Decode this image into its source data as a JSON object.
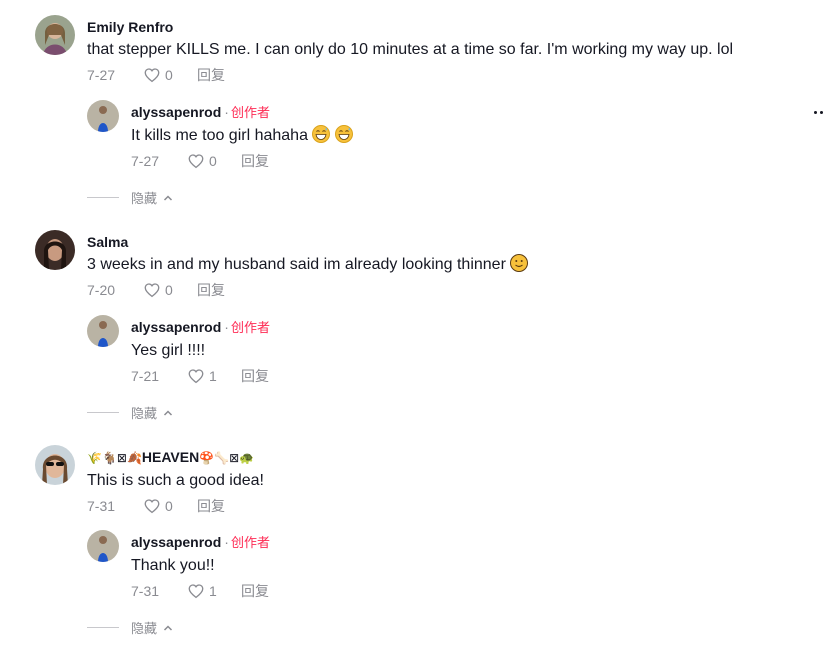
{
  "comments": [
    {
      "username": "Emily Renfro",
      "text": "that stepper KILLS me. I can only do 10 minutes at a time so far. I'm working my way up. lol",
      "date": "7-27",
      "likes": "0",
      "reply_label": "回复",
      "reply": {
        "username": "alyssapenrod",
        "creator_sep": "·",
        "creator_label": "创作者",
        "text": "It kills me too girl hahaha",
        "date": "7-27",
        "likes": "0",
        "reply_label": "回复"
      },
      "hide_label": "隐藏"
    },
    {
      "username": "Salma",
      "text": "3 weeks in and my husband said im already looking thinner",
      "date": "7-20",
      "likes": "0",
      "reply_label": "回复",
      "reply": {
        "username": "alyssapenrod",
        "creator_sep": "·",
        "creator_label": "创作者",
        "text": "Yes girl !!!!",
        "date": "7-21",
        "likes": "1",
        "reply_label": "回复"
      },
      "hide_label": "隐藏"
    },
    {
      "username_prefix_emojis": "🌾🐐⊠🍂",
      "username": "HEAVEN",
      "username_suffix_emojis": "🍄🦴⊠🐢",
      "text": "This is such a good idea!",
      "date": "7-31",
      "likes": "0",
      "reply_label": "回复",
      "reply": {
        "username": "alyssapenrod",
        "creator_sep": "·",
        "creator_label": "创作者",
        "text": "Thank you!!",
        "date": "7-31",
        "likes": "1",
        "reply_label": "回复"
      },
      "hide_label": "隐藏"
    }
  ],
  "icons": {
    "like": "heart-outline-icon",
    "collapse": "chevron-up-icon",
    "more": "more-options-icon",
    "grin_emoji": "grinning-sweat-emoji",
    "smile_emoji": "slightly-smiling-emoji"
  },
  "colors": {
    "creator": "#fe2c55",
    "secondary_text": "#8a8b91",
    "primary_text": "#161823"
  }
}
